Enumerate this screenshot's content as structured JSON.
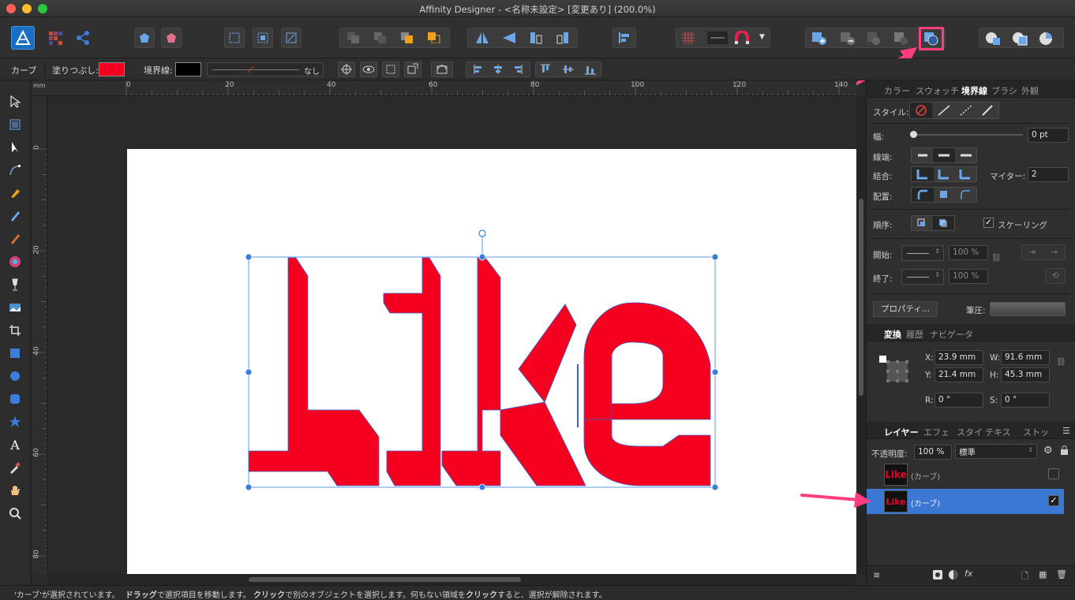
{
  "window": {
    "title": "Affinity Designer - <名称未設定> [変更あり] (200.0%)"
  },
  "context_bar": {
    "tool": "カーブ",
    "fill_label": "塗りつぶし:",
    "stroke_label": "境界線:",
    "stroke_value": "なし",
    "fill_color": "#f5001e",
    "stroke_color": "#000000"
  },
  "ruler": {
    "unit": "mm",
    "top_labels": [
      "0",
      "20",
      "40",
      "60",
      "80",
      "100",
      "120",
      "140"
    ],
    "left_labels": [
      "0",
      "20",
      "40",
      "60",
      "80"
    ]
  },
  "canvas": {
    "text": "Like",
    "shape_color": "#f5001e",
    "selection_color": "#3b7ddd"
  },
  "stroke_panel": {
    "tabs": [
      "カラー",
      "スウォッチ",
      "境界線",
      "ブラシ",
      "外観"
    ],
    "active_tab": "境界線",
    "style_label": "スタイル:",
    "width_label": "幅:",
    "width_value": "0 pt",
    "cap_label": "線端:",
    "join_label": "結合:",
    "miter_label": "マイター:",
    "miter_value": "2",
    "align_label": "配置:",
    "order_label": "順序:",
    "scaling_label": "スケーリング",
    "start_label": "開始:",
    "start_percent": "100 %",
    "end_label": "終了:",
    "end_percent": "100 %",
    "properties_button": "プロパティ...",
    "pressure_label": "筆圧:"
  },
  "transform_panel": {
    "tabs": [
      "変換",
      "履歴",
      "ナビゲータ"
    ],
    "active_tab": "変換",
    "x_label": "X:",
    "x_value": "23.9 mm",
    "y_label": "Y:",
    "y_value": "21.4 mm",
    "w_label": "W:",
    "w_value": "91.6 mm",
    "h_label": "H:",
    "h_value": "45.3 mm",
    "r_label": "R:",
    "r_value": "0 °",
    "s_label": "S:",
    "s_value": "0 °"
  },
  "layers_panel": {
    "tabs": [
      "レイヤー",
      "エフェ",
      "スタイ",
      "テキス",
      "ストッ"
    ],
    "active_tab": "レイヤー",
    "opacity_label": "不透明度:",
    "opacity_value": "100 %",
    "blend_mode": "標準",
    "layers": [
      {
        "name": "(カーブ)",
        "thumb_text": "Like",
        "selected": false,
        "checked": false
      },
      {
        "name": "(カーブ)",
        "thumb_text": "Like",
        "selected": true,
        "checked": true
      }
    ]
  },
  "status": {
    "p1": "'カーブ'が選択されています。",
    "b1": "ドラッグ",
    "p2": "で選択項目を移動します。",
    "b2": "クリック",
    "p3": "で別のオブジェクトを選択します。何もない領域を",
    "b3": "クリック",
    "p4": "すると、選択が解除されます。"
  },
  "colors": {
    "accent": "#3b7ddd",
    "annotation": "#ff3d7f",
    "selected_layer": "#3a78d4"
  }
}
